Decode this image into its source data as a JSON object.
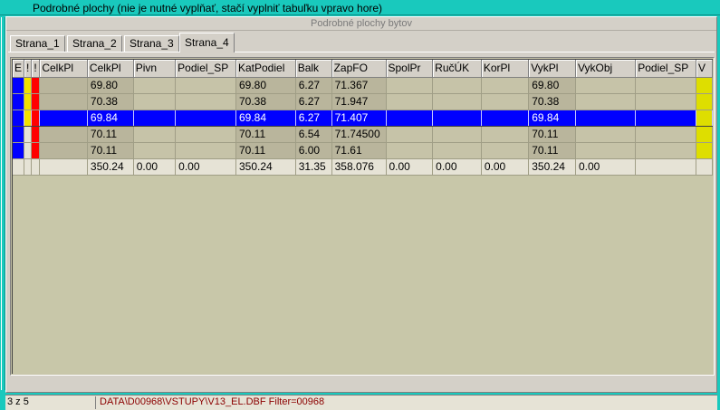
{
  "window": {
    "title": "Podrobné plochy (nie je nutné vyplňať, stačí vyplniť tabuľku vpravo hore)"
  },
  "panel": {
    "header": "Podrobné plochy bytov"
  },
  "tabs": [
    {
      "label": "Strana_1",
      "active": false
    },
    {
      "label": "Strana_2",
      "active": false
    },
    {
      "label": "Strana_3",
      "active": false
    },
    {
      "label": "Strana_4",
      "active": true
    }
  ],
  "grid": {
    "columns": [
      "E",
      "!",
      "!",
      "CelkPl",
      "CelkPl",
      "Pivn",
      "Podiel_SP",
      "KatPodiel",
      "Balk",
      "ZapFO",
      "SpolPr",
      "RučÚK",
      "KorPl",
      "VykPl",
      "VykObj",
      "Podiel_SP",
      "V"
    ],
    "rows": [
      {
        "celk_pl_a": "",
        "celk_pl": "69.80",
        "pivn": "",
        "podiel_sp": "",
        "kat_podiel": "69.80",
        "balk": "6.27",
        "zap_fo": "71.367",
        "spol_pr": "",
        "ruc_uk": "",
        "kor_pl": "",
        "vyk_pl": "69.80",
        "vyk_obj": "",
        "podiel_sp2": ""
      },
      {
        "celk_pl_a": "",
        "celk_pl": "70.38",
        "pivn": "",
        "podiel_sp": "",
        "kat_podiel": "70.38",
        "balk": "6.27",
        "zap_fo": "71.947",
        "spol_pr": "",
        "ruc_uk": "",
        "kor_pl": "",
        "vyk_pl": "70.38",
        "vyk_obj": "",
        "podiel_sp2": ""
      },
      {
        "celk_pl_a": "",
        "celk_pl": "69.84",
        "pivn": "",
        "podiel_sp": "",
        "kat_podiel": "69.84",
        "balk": "6.27",
        "zap_fo": "71.407",
        "spol_pr": "",
        "ruc_uk": "",
        "kor_pl": "",
        "vyk_pl": "69.84",
        "vyk_obj": "",
        "podiel_sp2": ""
      },
      {
        "celk_pl_a": "",
        "celk_pl": "70.11",
        "pivn": "",
        "podiel_sp": "",
        "kat_podiel": "70.11",
        "balk": "6.54",
        "zap_fo": "71.74500",
        "spol_pr": "",
        "ruc_uk": "",
        "kor_pl": "",
        "vyk_pl": "70.11",
        "vyk_obj": "",
        "podiel_sp2": ""
      },
      {
        "celk_pl_a": "",
        "celk_pl": "70.11",
        "pivn": "",
        "podiel_sp": "",
        "kat_podiel": "70.11",
        "balk": "6.00",
        "zap_fo": "71.61",
        "spol_pr": "",
        "ruc_uk": "",
        "kor_pl": "",
        "vyk_pl": "70.11",
        "vyk_obj": "",
        "podiel_sp2": ""
      }
    ],
    "totals": {
      "celk_pl": "350.24",
      "pivn": "0.00",
      "podiel_sp": "0.00",
      "kat_podiel": "350.24",
      "balk": "31.35",
      "zap_fo": "358.076",
      "spol_pr": "0.00",
      "ruc_uk": "0.00",
      "kor_pl": "0.00",
      "vyk_pl": "350.24",
      "vyk_obj": "0.00"
    }
  },
  "status": {
    "record": "3 z 5",
    "path": "DATA\\D00968\\VSTUPY\\V13_EL.DBF Filter=00968"
  },
  "colors": {
    "frame": "#19c9bd",
    "selection": "#0000ff",
    "marker_blue": "#0000ff",
    "marker_yellow": "#f2e100",
    "marker_red": "#ff0000",
    "v_column": "#dede00",
    "status_path": "#8b0000"
  }
}
